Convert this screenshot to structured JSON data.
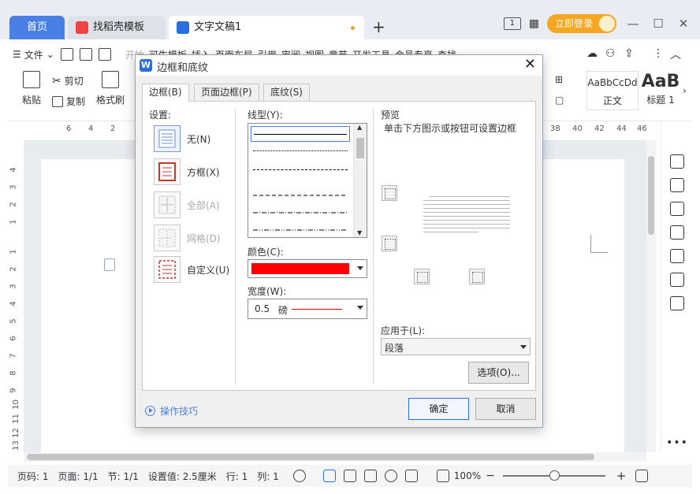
{
  "tabs": {
    "home": "首页",
    "template": "找稻壳模板",
    "document": "文字文稿1",
    "new_tab": "+"
  },
  "titlebar": {
    "login": "立即登录",
    "page_badge": "1",
    "minimize": "—",
    "maximize": "☐",
    "close": "✕"
  },
  "menu": {
    "file": "文件",
    "items": [
      "开始",
      "可生模板",
      "插入",
      "页面布局",
      "引用",
      "审阅",
      "视图",
      "章节",
      "开发工具",
      "会员专享"
    ],
    "search": "查找"
  },
  "ribbon": {
    "paste": "粘贴",
    "cut": "剪切",
    "copy": "复制",
    "format_painter": "格式刷",
    "style1_preview": "AaBbCcDd",
    "style1_name": "正文",
    "style2_preview": "AaB",
    "style2_name": "标题 1"
  },
  "ruler": {
    "top": [
      "6",
      "4",
      "2",
      "38",
      "40",
      "42",
      "44",
      "46"
    ],
    "left": [
      "4",
      "3",
      "2",
      "1",
      "1",
      "2",
      "3",
      "4",
      "5",
      "6",
      "7",
      "8",
      "9",
      "10",
      "11",
      "12",
      "13"
    ]
  },
  "dialog": {
    "title": "边框和底纹",
    "tabs": [
      "边框(B)",
      "页面边框(P)",
      "底纹(S)"
    ],
    "settings_label": "设置:",
    "settings": [
      "无(N)",
      "方框(X)",
      "全部(A)",
      "网格(D)",
      "自定义(U)"
    ],
    "line_style_label": "线型(Y):",
    "color_label": "颜色(C):",
    "color_value": "#ff0000",
    "width_label": "宽度(W):",
    "width_value": "0.5",
    "width_unit": "磅",
    "preview_label": "预览",
    "preview_hint": "单击下方图示或按钮可设置边框",
    "apply_label": "应用于(L):",
    "apply_value": "段落",
    "options_button": "选项(O)...",
    "ok_button": "确定",
    "cancel_button": "取消",
    "tips": "操作技巧"
  },
  "status": {
    "page_num": "页码: 1",
    "pages": "页面: 1/1",
    "section": "节: 1/1",
    "setting_value": "设置值: 2.5厘米",
    "row": "行: 1",
    "col": "列: 1",
    "zoom": "100%",
    "zoom_level": 0.5,
    "zoom_minus": "−",
    "zoom_plus": "+"
  },
  "colors": {
    "accent": "#4a7fe3",
    "login": "#f5a623",
    "border_color": "#ff0000"
  }
}
